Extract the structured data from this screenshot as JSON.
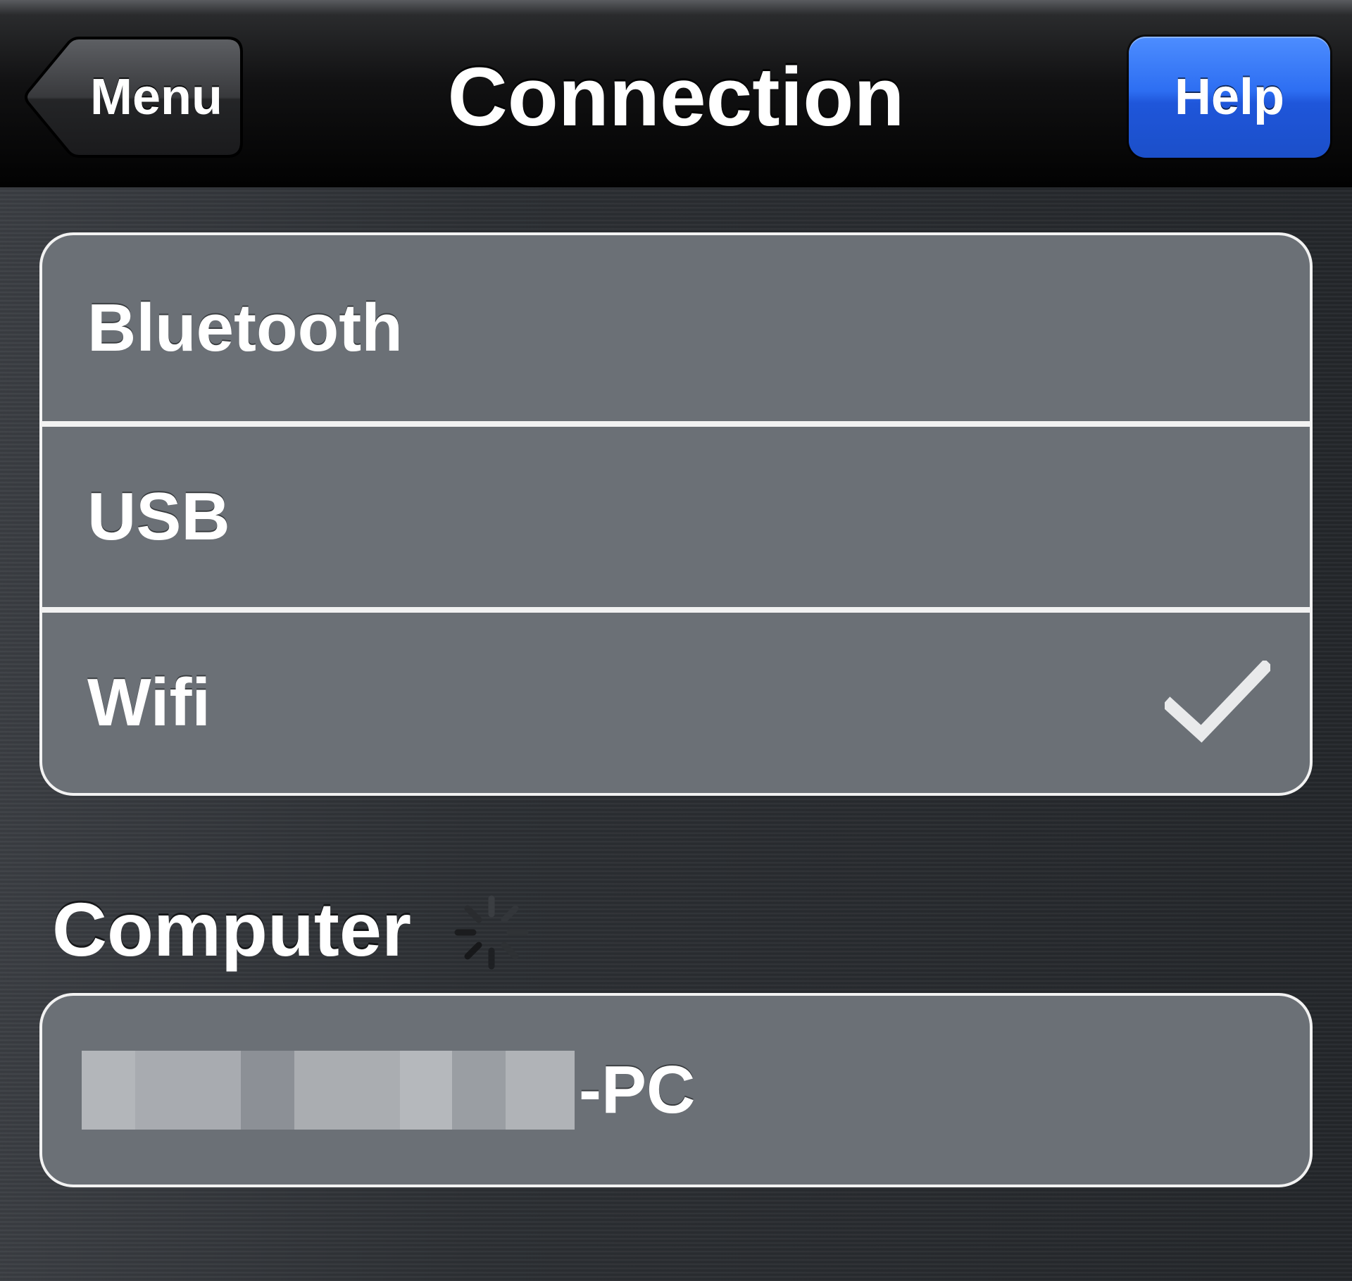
{
  "navbar": {
    "back_label": "Menu",
    "title": "Connection",
    "help_label": "Help"
  },
  "connection": {
    "options": [
      {
        "label": "Bluetooth",
        "selected": false
      },
      {
        "label": "USB",
        "selected": false
      },
      {
        "label": "Wifi",
        "selected": true
      }
    ]
  },
  "computer": {
    "section_title": "Computer",
    "name_visible": "-PC",
    "name_redacted": true,
    "loading": true
  },
  "colors": {
    "help_button": "#2d6ef2",
    "row_background": "#6b7076",
    "row_border": "#f2f2f2",
    "text": "#ffffff"
  },
  "icons": {
    "back": "chevron-left-icon",
    "selected": "checkmark-icon",
    "loading": "spinner-icon"
  }
}
